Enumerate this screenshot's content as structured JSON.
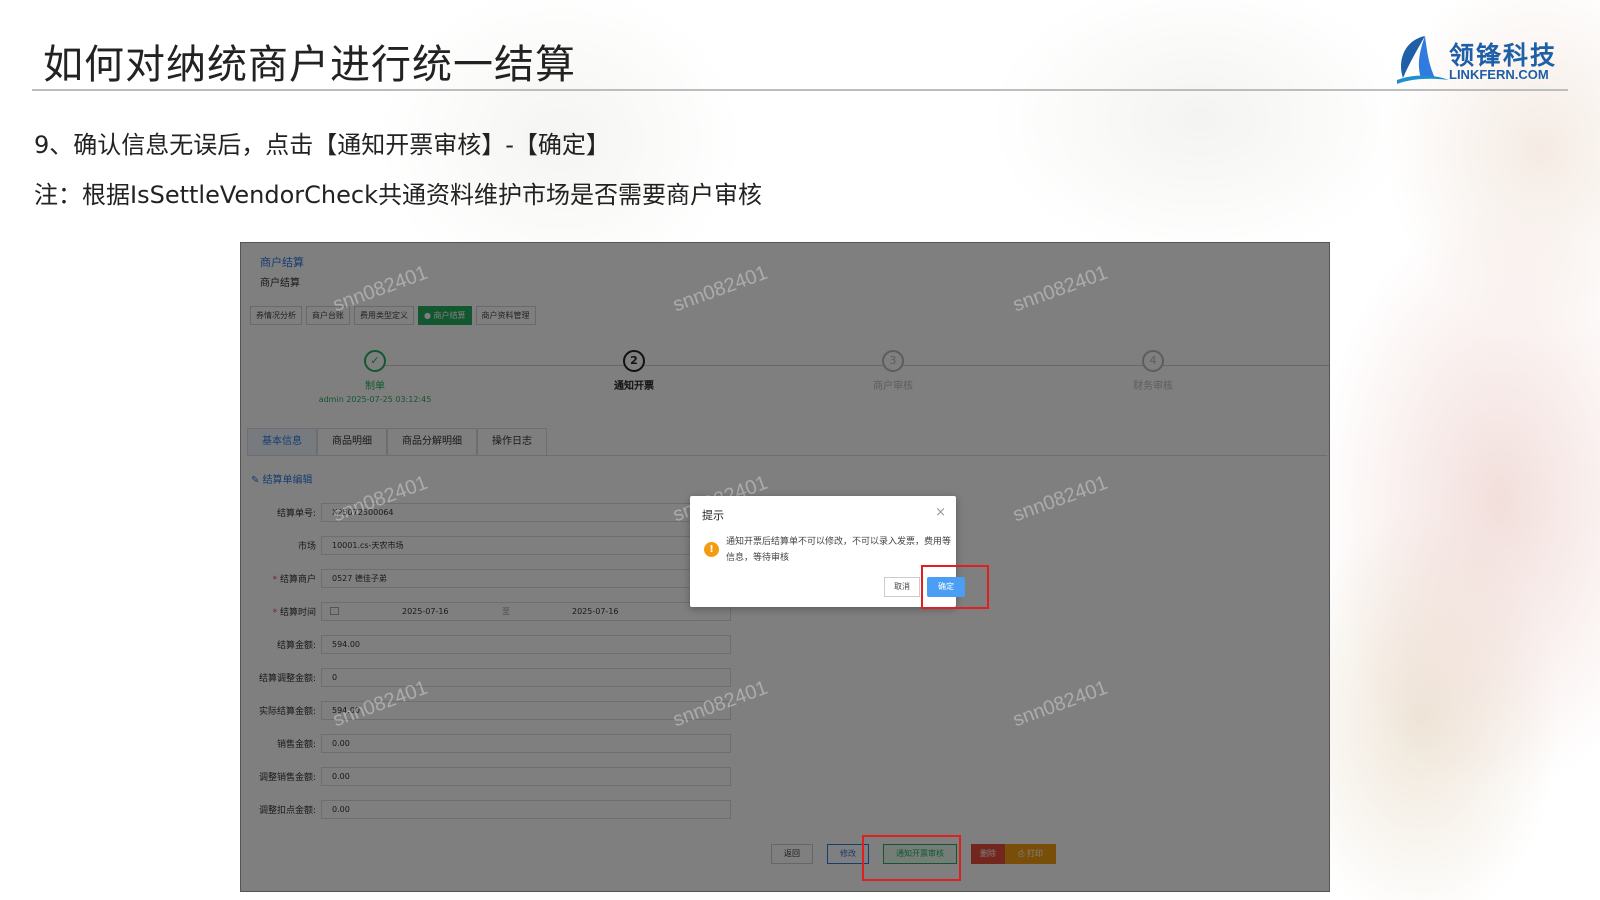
{
  "slide": {
    "title": "如何对纳统商户进行统一结算",
    "step_text": "9、确认信息无误后，点击【通知开票审核】-【确定】",
    "note_text": "注：根据IsSettleVendorCheck共通资料维护市场是否需要商户审核"
  },
  "logo": {
    "cn": "领锋科技",
    "en": "LINKFERN.COM",
    "color": "#1e5fa8"
  },
  "app": {
    "title": "商户结算",
    "subtitle": "商户结算",
    "nav_tabs": [
      {
        "label": "券情况分析"
      },
      {
        "label": "商户台账"
      },
      {
        "label": "费用类型定义"
      },
      {
        "label": "● 商户结算"
      },
      {
        "label": "商户资料管理"
      }
    ],
    "steps": [
      {
        "num": "✓",
        "label": "制单",
        "sub": "admin 2025-07-25 03:12:45"
      },
      {
        "num": "2",
        "label": "通知开票"
      },
      {
        "num": "3",
        "label": "商户审核"
      },
      {
        "num": "4",
        "label": "财务审核"
      }
    ],
    "page_tabs": [
      {
        "label": "基本信息"
      },
      {
        "label": "商品明细"
      },
      {
        "label": "商品分解明细"
      },
      {
        "label": "操作日志"
      }
    ],
    "section_heading": "结算单编辑",
    "form": {
      "settle_no": {
        "label": "结算单号",
        "value": "X25072500064"
      },
      "market": {
        "label": "市场",
        "value": "10001.cs-天农市场"
      },
      "vendor": {
        "label": "结算商户",
        "value": "0527 德佳子弟"
      },
      "period": {
        "label": "结算时间",
        "from": "2025-07-16",
        "to_word": "至",
        "to": "2025-07-16"
      },
      "amount": {
        "label": "结算金额",
        "value": "594.00"
      },
      "adjust_amount": {
        "label": "结算调整金额",
        "value": "0"
      },
      "actual_amount": {
        "label": "实际结算金额",
        "value": "594.00"
      },
      "sales_amount": {
        "label": "销售金额",
        "value": "0.00"
      },
      "adj_sales_amount": {
        "label": "调整销售金额",
        "value": "0.00"
      },
      "adj_deduct_amount": {
        "label": "调整扣点金额",
        "value": "0.00"
      }
    },
    "buttons": {
      "back": "返回",
      "edit": "修改",
      "notify": "通知开票审核",
      "delete": "删除",
      "print": "⎙ 打印"
    },
    "watermark": "snn082401",
    "accent_green": "#27ae60",
    "accent_blue": "#2f7be0"
  },
  "dialog": {
    "title": "提示",
    "close": "×",
    "warn_icon": "!",
    "message": "通知开票后结算单不可以修改，不可以录入发票，费用等信息，等待审核",
    "cancel": "取消",
    "ok": "确定"
  }
}
